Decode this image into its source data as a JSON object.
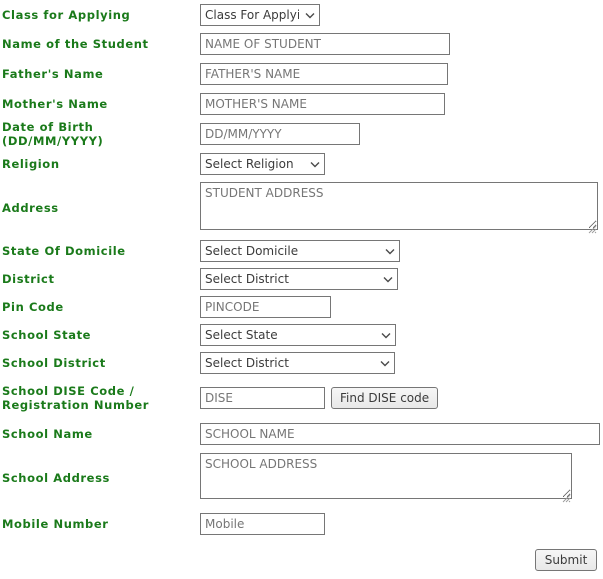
{
  "form": {
    "fields": [
      {
        "label": "Class for Applying",
        "control": "select",
        "value": "Class For Applying",
        "name": "class-for-applying"
      },
      {
        "label": "Name of the Student",
        "control": "text",
        "placeholder": "NAME OF STUDENT",
        "value": "",
        "name": "student-name"
      },
      {
        "label": "Father's Name",
        "control": "text",
        "placeholder": "FATHER'S NAME",
        "value": "",
        "name": "father-name"
      },
      {
        "label": "Mother's Name",
        "control": "text",
        "placeholder": "MOTHER'S NAME",
        "value": "",
        "name": "mother-name"
      },
      {
        "label": "Date of Birth (DD/MM/YYYY)",
        "control": "text",
        "placeholder": "DD/MM/YYYY",
        "value": "",
        "name": "date-of-birth"
      },
      {
        "label": "Religion",
        "control": "select",
        "value": "Select Religion",
        "name": "religion"
      },
      {
        "label": "Address",
        "control": "textarea",
        "placeholder": "STUDENT ADDRESS",
        "value": "",
        "name": "student-address"
      },
      {
        "label": "State Of Domicile",
        "control": "select",
        "value": "Select Domicile",
        "name": "state-of-domicile"
      },
      {
        "label": "District",
        "control": "select",
        "value": "Select District",
        "name": "district"
      },
      {
        "label": "Pin  Code",
        "control": "text",
        "placeholder": "PINCODE",
        "value": "",
        "name": "pin-code"
      },
      {
        "label": "School State",
        "control": "select",
        "value": "Select State",
        "name": "school-state"
      },
      {
        "label": "School District",
        "control": "select",
        "value": "Select District",
        "name": "school-district"
      },
      {
        "label": "School DISE Code / Registration Number",
        "control": "text-with-button",
        "placeholder": "DISE",
        "value": "",
        "button_label": "Find DISE code",
        "name": "school-dise-code"
      },
      {
        "label": "School Name",
        "control": "text",
        "placeholder": "SCHOOL NAME",
        "value": "",
        "name": "school-name"
      },
      {
        "label": "School Address",
        "control": "textarea",
        "placeholder": "SCHOOL ADDRESS",
        "value": "",
        "name": "school-address"
      },
      {
        "label": "Mobile Number",
        "control": "text",
        "placeholder": "Mobile",
        "value": "",
        "name": "mobile-number"
      }
    ],
    "submit_label": "Submit"
  },
  "colors": {
    "label_green": "#1a7a1a",
    "border_gray": "#767676",
    "placeholder_gray": "#767676",
    "button_face": "#efefef",
    "page_background": "#ffffff"
  }
}
